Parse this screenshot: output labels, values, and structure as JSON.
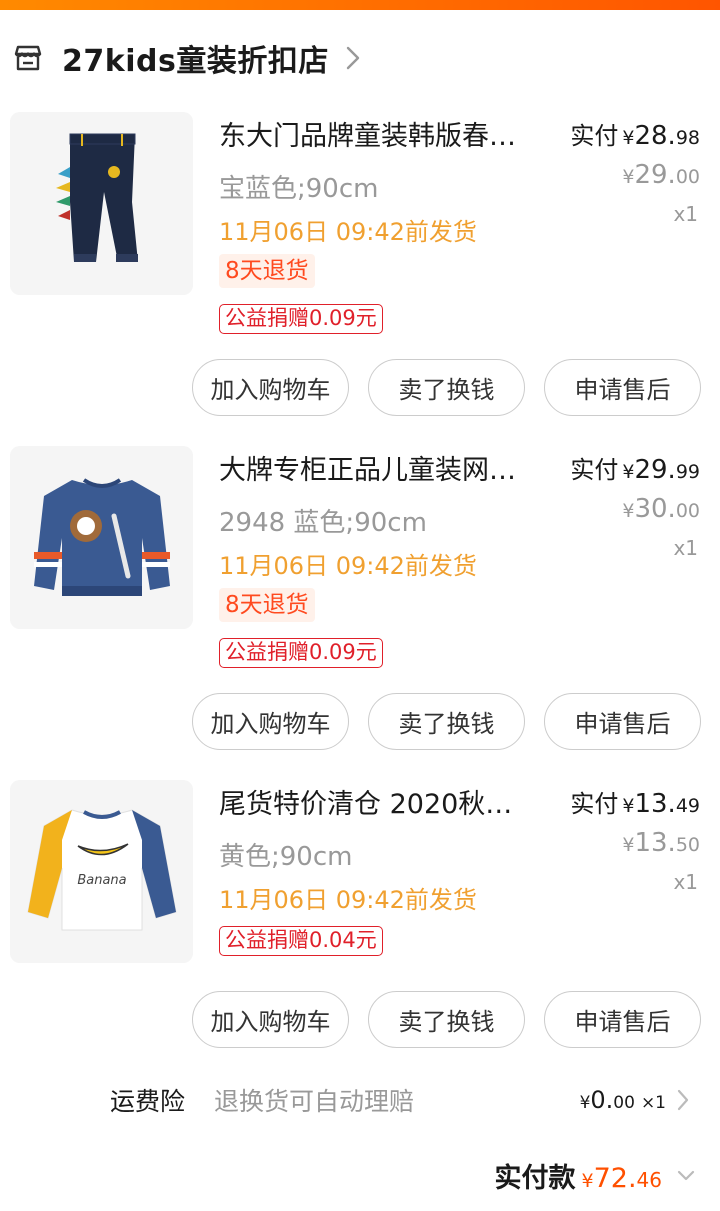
{
  "colors": {
    "accent": "#ff5000",
    "top_bar": "#ff7a00",
    "ship_text": "#f0a030",
    "return_text": "#ff4a1f",
    "charity": "#e0202a",
    "muted": "#999999"
  },
  "shop": {
    "name": "27kids童装折扣店",
    "icon": "store-icon"
  },
  "labels": {
    "paid": "实付",
    "yen": "¥"
  },
  "items": [
    {
      "title": "东大门品牌童装韩版春…",
      "spec": "宝蓝色;90cm",
      "ship": "11月06日 09:42前发货",
      "return_tag": "8天退货",
      "charity": "公益捐赠0.09元",
      "paid_int": "28.",
      "paid_dec": "98",
      "orig_int": "29.",
      "orig_dec": "00",
      "qty": "x1",
      "image": "navy-pants-image",
      "buttons": [
        "加入购物车",
        "卖了换钱",
        "申请售后"
      ]
    },
    {
      "title": "大牌专柜正品儿童装网…",
      "spec": "2948 蓝色;90cm",
      "ship": "11月06日 09:42前发货",
      "return_tag": "8天退货",
      "charity": "公益捐赠0.09元",
      "paid_int": "29.",
      "paid_dec": "99",
      "orig_int": "30.",
      "orig_dec": "00",
      "qty": "x1",
      "image": "blue-sweatshirt-image",
      "buttons": [
        "加入购物车",
        "卖了换钱",
        "申请售后"
      ]
    },
    {
      "title": "尾货特价清仓 2020秋…",
      "spec": "黄色;90cm",
      "ship": "11月06日 09:42前发货",
      "charity": "公益捐赠0.04元",
      "paid_int": "13.",
      "paid_dec": "49",
      "orig_int": "13.",
      "orig_dec": "50",
      "qty": "x1",
      "image": "banana-tee-image",
      "image_text": "Banana",
      "buttons": [
        "加入购物车",
        "卖了换钱",
        "申请售后"
      ]
    }
  ],
  "insurance": {
    "label": "运费险",
    "desc": "退换货可自动理赔",
    "price_int": "0.",
    "price_dec": "00",
    "qty": "×1"
  },
  "total": {
    "label": "实付款",
    "int": "72.",
    "dec": "46"
  }
}
